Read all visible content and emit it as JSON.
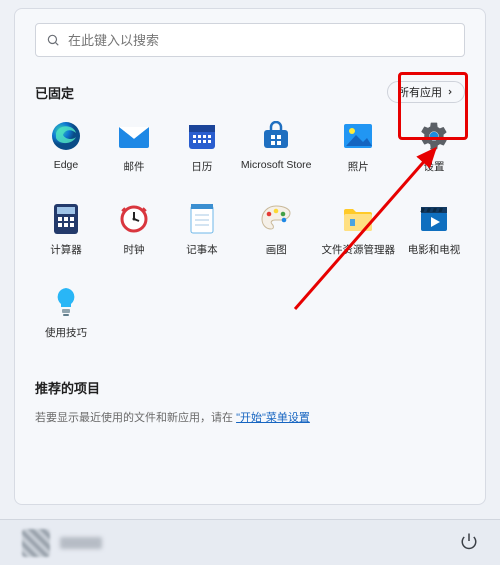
{
  "search": {
    "placeholder": "在此键入以搜索"
  },
  "pinned": {
    "title": "已固定",
    "all_label": "所有应用",
    "apps": [
      {
        "id": "edge",
        "label": "Edge"
      },
      {
        "id": "mail",
        "label": "邮件"
      },
      {
        "id": "calendar",
        "label": "日历"
      },
      {
        "id": "store",
        "label": "Microsoft Store"
      },
      {
        "id": "photos",
        "label": "照片"
      },
      {
        "id": "settings",
        "label": "设置"
      },
      {
        "id": "calc",
        "label": "计算器"
      },
      {
        "id": "clock",
        "label": "时钟"
      },
      {
        "id": "notepad",
        "label": "记事本"
      },
      {
        "id": "paint",
        "label": "画图"
      },
      {
        "id": "explorer",
        "label": "文件资源管理器"
      },
      {
        "id": "movies",
        "label": "电影和电视"
      },
      {
        "id": "tips",
        "label": "使用技巧"
      }
    ]
  },
  "recommended": {
    "title": "推荐的项目",
    "hint_prefix": "若要显示最近使用的文件和新应用，请在",
    "hint_link": "\"开始\"菜单设置"
  },
  "highlight_target": "settings"
}
